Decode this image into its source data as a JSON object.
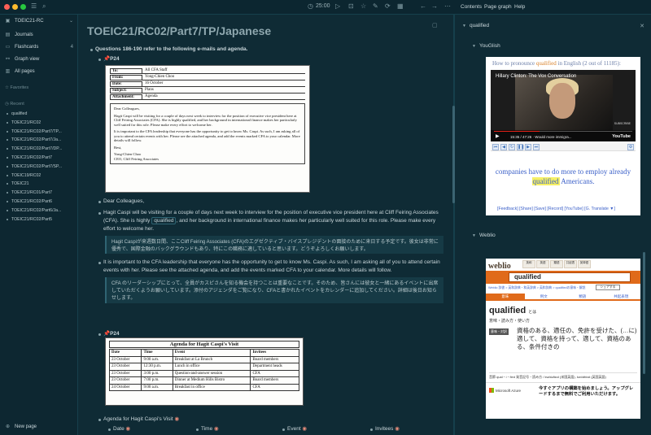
{
  "topbar": {
    "colors": [
      "#ff5f57",
      "#febc2e",
      "#28c840"
    ],
    "timer": "25:00",
    "right_tabs": [
      "Contents",
      "Page graph",
      "Help"
    ]
  },
  "sidebar": {
    "workspace": "TOEIC21-RC",
    "nav": [
      {
        "icon": "journals-icon",
        "label": "Journals",
        "count": ""
      },
      {
        "icon": "flashcards-icon",
        "label": "Flashcards",
        "count": "4"
      },
      {
        "icon": "graph-icon",
        "label": "Graph view",
        "count": ""
      },
      {
        "icon": "pages-icon",
        "label": "All pages",
        "count": ""
      }
    ],
    "favorites_label": "Favorites",
    "recent_label": "Recent",
    "recent": [
      "qualified",
      "TOEIC21/RC02",
      "TOEIC21/RC02/Part7/TP...",
      "TOEIC21/RC02/Part7/Ja...",
      "TOEIC21/RC02/Part7/DP...",
      "TOEIC21/RC02/Part7",
      "TOEIC21/RC02/Part7/SP...",
      "TOEIC19/RC02",
      "TOEIC21",
      "TOEIC21/RC01/Part7",
      "TOEIC21/RC02/Part6",
      "TOEIC21/RC02/Part6/Ja...",
      "TOEIC21/RC02/Part5"
    ],
    "new_page": "New page"
  },
  "main": {
    "title": "TOEIC21/RC02/Part7/TP/Japanese",
    "questions": "Questions 186-190 refer to the following e-mails and agenda.",
    "p24a": "P24",
    "memo": {
      "rows": [
        {
          "label": "To:",
          "value": "All CFA Staff"
        },
        {
          "label": "From:",
          "value": "Yong-Chien Choo"
        },
        {
          "label": "Date:",
          "value": "16 October"
        },
        {
          "label": "Subject:",
          "value": "Plans"
        },
        {
          "label": "Attachment:",
          "value": "Agenda"
        }
      ],
      "greeting": "Dear Colleagues,",
      "p1": "Hagit Caspi will be visiting for a couple of days next week to interview for the position of executive vice president here at Cliff Feiring Associates (CFA). She is highly qualified, and her background in international finance makes her particularly well suited for this role. Please make every effort to welcome her.",
      "p2": "It is important to the CFA leadership that everyone has the opportunity to get to know Ms. Caspi. As such, I am asking all of you to attend certain events with her. Please see the attached agenda, and add the events marked CFA to your calendar. More details will follow.",
      "sign1": "Best,",
      "sign2": "Yong-Chien Choo",
      "sign3": "CEO, Cliff Feiring Associates"
    },
    "dear": "Dear Colleagues,",
    "para1_before": "Hagit Caspi will be visiting for a couple of days next week to interview for the position of executive vice president here at Cliff Feiring Associates (CFA). She is highly",
    "para1_link": "qualified",
    "para1_after": ", and her background in international finance makes her particularly well suited for this role. Please make every effort to welcome her.",
    "jp1": "Hagit Caspiが来週数日間、ここCliff Feiring Associates (CFA)のエグゼクティブ・バイスプレジデントの面接のために来日する予定です。彼女は非常に優秀で、国際金融のバックグラウンドもあり、特にこの職務に適していると思います。どうぞよろしくお願いします。",
    "para2": "It is important to the CFA leadership that everyone has the opportunity to get to know Ms. Caspi. As such, I am asking all of you to attend certain events with her. Please see the attached agenda, and add the events marked CFA to your calendar. More details will follow.",
    "jp2": "CFA のリーダーシップにとって、全員がカスピさんを知る機会を持つことは重要なことです。そのため、皆さんには彼女と一緒にあるイベントに出席していただくようお願いしています。添付のアジェンダをご覧になり、CFAと書かれたイベントをカレンダーに追加してください。詳細は後日お知らせします。",
    "p24b": "P24",
    "agenda": {
      "title": "Agenda for Hagit Caspi's Visit",
      "headers": [
        "Date",
        "Time",
        "Event",
        "Invitees"
      ],
      "rows": [
        [
          "23 October",
          "9:00 a.m.",
          "Breakfast at La Brunch",
          "Board members"
        ],
        [
          "23 October",
          "12:30 p.m.",
          "Lunch in office",
          "Department heads"
        ],
        [
          "23 October",
          "3:00 p.m.",
          "Question-and-answer session",
          "CFA"
        ],
        [
          "23 October",
          "7:00 p.m.",
          "Dinner at Medium Hills Bistro",
          "Board members"
        ],
        [
          "24 October",
          "9:00 a.m.",
          "Breakfast in office",
          "CFA"
        ]
      ]
    },
    "agenda_bullet": "Agenda for Hagit Caspi's Visit",
    "cols": [
      "Date",
      "Time",
      "Event",
      "Invitees"
    ]
  },
  "right": {
    "page": "qualified",
    "youglish": {
      "header": "YouGlish",
      "title_pre": "How to pronounce",
      "title_word": "qualified",
      "title_post": "in English (2 out of 11185):",
      "video_title": "Hillary Clinton: The Vox Conversation",
      "progress": 0.33,
      "time": "15:35 / 47:26 · Would more immigra...",
      "subscribe": "SUBSCRIBE",
      "yt": "YouTube",
      "caption_pre": "companies have to do more to employ already",
      "caption_word": "qualified",
      "caption_post": "Americans.",
      "links": "[Feedback] [Share] [Save] [Record] [YouTube] [G. Translate ▼]"
    },
    "weblio": {
      "header": "Weblio",
      "logo": "weblio",
      "tabs": [
        "英和",
        "英語",
        "類語",
        "共起表",
        "英単語"
      ],
      "search": "qualified",
      "crumb": "Weblio 辞書 > 英和辞典・和英辞典 > 英和辞典 > qualifiedの意味・解説",
      "share": "シェアする",
      "nav": [
        "意味",
        "例文",
        "類語",
        "共起表現"
      ],
      "word": "qualified",
      "word_suffix": "とは",
      "sub": "意味・読み方・使い方",
      "tag": "意味・対訳",
      "def": "資格のある、適任の、免許を受けた、(…に)適して、資格を持って、適して、資格のある、条件付きの",
      "pron": "音節 qual・i・fied  発音記号・読み方 / kwάlǝfὰɪd (米国英語), kwɔ́lɪfὰɪd (英国英語)",
      "ms": "Microsoft Azure",
      "ad": "今すぐアプリの構築を始めましょう。アップグレードするまで無料でご利用いただけます。"
    }
  }
}
